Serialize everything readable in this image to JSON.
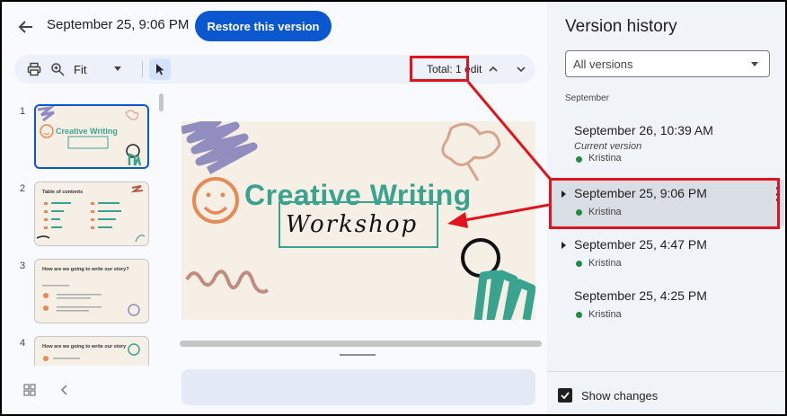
{
  "header": {
    "title": "September 25, 9:06 PM",
    "restore_label": "Restore this version"
  },
  "toolbar": {
    "print_icon": "print-icon",
    "zoom_icon": "zoom-in-icon",
    "zoom_value": "Fit",
    "select_icon": "cursor-icon",
    "total_edits": "Total: 1 edit",
    "nav_up_icon": "chevron-up-icon",
    "nav_down_icon": "chevron-down-icon"
  },
  "thumbnails": [
    {
      "num": "1",
      "title": "Creative Writing",
      "selected": true
    },
    {
      "num": "2",
      "title": "Table of contents",
      "selected": false
    },
    {
      "num": "3",
      "title": "How are we going to write our story?",
      "selected": false
    },
    {
      "num": "4",
      "title": "How are we going to write our story",
      "selected": false
    }
  ],
  "slide": {
    "title": "Creative Writing",
    "subtitle": "Workshop"
  },
  "panel": {
    "title": "Version history",
    "filter_value": "All versions",
    "section": "September",
    "versions": [
      {
        "date": "September 26, 10:39 AM",
        "current": "Current version",
        "author": "Kristina",
        "active": false
      },
      {
        "date": "September 25, 9:06 PM",
        "current": "",
        "author": "Kristina",
        "active": true
      },
      {
        "date": "September 25, 4:47 PM",
        "current": "",
        "author": "Kristina",
        "active": false
      },
      {
        "date": "September 25, 4:25 PM",
        "current": "",
        "author": "Kristina",
        "active": false
      }
    ],
    "show_changes_label": "Show changes",
    "show_changes_checked": true
  },
  "colors": {
    "accent": "#0b57d0",
    "slide_teal": "#3aa38f",
    "annotation_red": "#e0141e",
    "author_dot": "#1e8e3e"
  }
}
